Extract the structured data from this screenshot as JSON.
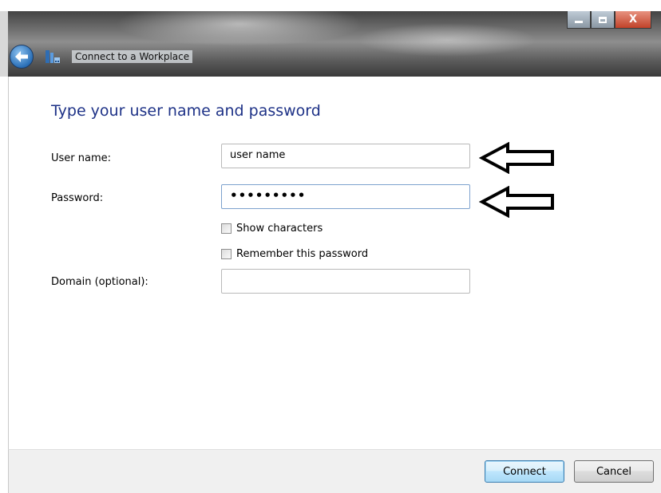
{
  "window": {
    "title": "Connect to a Workplace",
    "controls": {
      "minimize_icon": "minimize-icon",
      "maximize_icon": "maximize-icon",
      "close_label": "X"
    }
  },
  "form": {
    "heading": "Type your user name and password",
    "username_label": "User name:",
    "username_value": "user name",
    "password_label": "Password:",
    "password_value": "•••••••••",
    "show_characters_label": "Show characters",
    "remember_password_label": "Remember this password",
    "domain_label": "Domain (optional):",
    "domain_value": ""
  },
  "annotations": {
    "arrow_icon": "left-arrow-icon"
  },
  "footer": {
    "connect_label": "Connect",
    "cancel_label": "Cancel"
  },
  "colors": {
    "heading": "#1e3287",
    "focus_border": "#7da2ce"
  }
}
